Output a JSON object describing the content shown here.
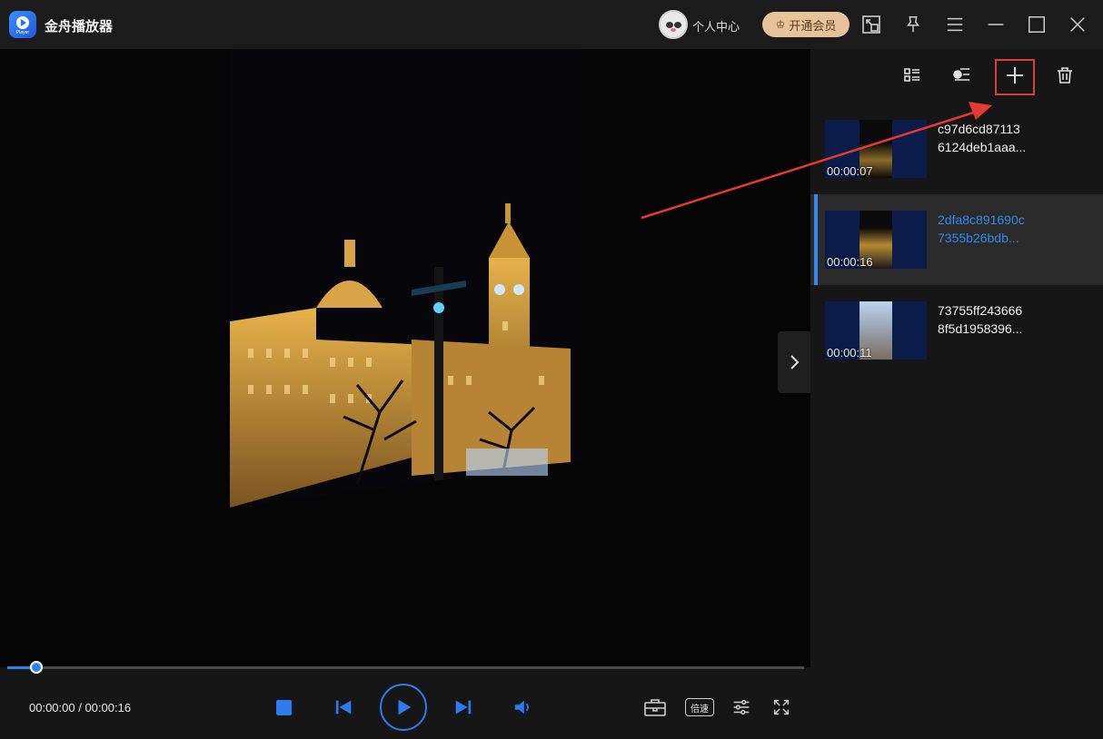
{
  "titlebar": {
    "app_name": "金舟播放器",
    "logo_sub": "Player",
    "user_center": "个人中心",
    "vip_button": "开通会员",
    "icons": [
      "mini-mode-icon",
      "pin-icon",
      "menu-icon",
      "minimize-icon",
      "maximize-icon",
      "close-icon"
    ]
  },
  "player": {
    "current_time": "00:00:00",
    "total_time": "00:00:16",
    "time_separator": " / ",
    "progress": 0.037,
    "speed_label": "倍速",
    "accent_color": "#2e7bf0"
  },
  "playlist": {
    "toolbar_icons": [
      "list-view-icon",
      "sort-icon",
      "add-icon",
      "delete-icon"
    ],
    "items": [
      {
        "name_line1": "c97d6cd87113",
        "name_line2": "6124deb1aaa...",
        "duration": "00:00:07",
        "active": false
      },
      {
        "name_line1": "2dfa8c891690c",
        "name_line2": "7355b26bdb...",
        "duration": "00:00:16",
        "active": true
      },
      {
        "name_line1": "73755ff243666",
        "name_line2": "8f5d1958396...",
        "duration": "00:00:11",
        "active": false
      }
    ]
  },
  "annotation": {
    "color": "#e53a34"
  }
}
